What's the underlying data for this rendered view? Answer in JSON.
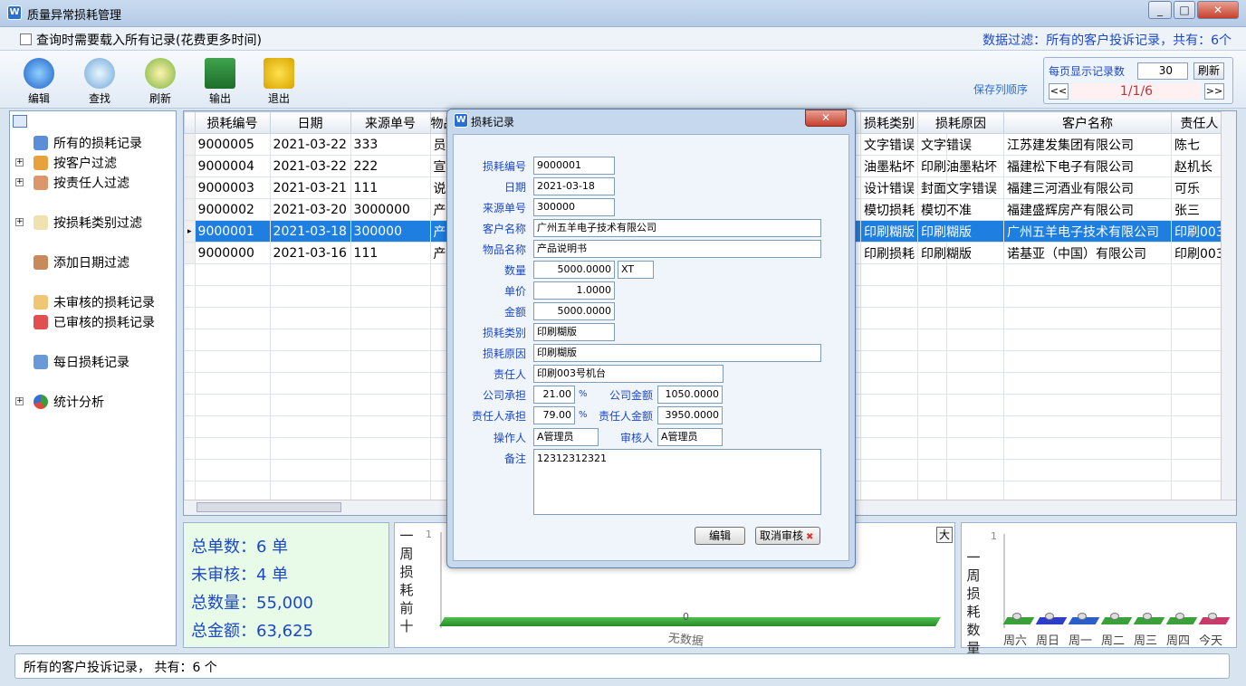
{
  "window": {
    "title": "质量异常损耗管理",
    "minimize": "_",
    "maximize": "□",
    "close": "✕"
  },
  "top": {
    "load_all_label": "查询时需要载入所有记录(花费更多时间)",
    "filter_text": "数据过滤：所有的客户投诉记录，共有：6个"
  },
  "toolbar": {
    "edit": "编辑",
    "find": "查找",
    "refresh": "刷新",
    "export": "输出",
    "exit": "退出",
    "save_order": "保存列顺序"
  },
  "pager": {
    "per_page_label": "每页显示记录数",
    "per_page": "30",
    "refresh": "刷新",
    "prev": "<<",
    "next": ">>",
    "page": "1/1/6"
  },
  "tree": {
    "items": [
      "所有的损耗记录",
      "按客户过滤",
      "按责任人过滤",
      "按损耗类别过滤",
      "添加日期过滤",
      "未审核的损耗记录",
      "已审核的损耗记录",
      "每日损耗记录",
      "统计分析"
    ]
  },
  "grid": {
    "columns": [
      "损耗编号",
      "日期",
      "来源单号",
      "物品",
      "损耗类别",
      "损耗原因",
      "客户名称",
      "责任人"
    ],
    "rows": [
      [
        "9000005",
        "2021-03-22",
        "333",
        "员工手",
        "文字错误",
        "文字错误",
        "江苏建发集团有限公司",
        "陈七"
      ],
      [
        "9000004",
        "2021-03-22",
        "222",
        "宣传单",
        "油墨粘坏",
        "印刷油墨粘坏",
        "福建松下电子有限公司",
        "赵机长"
      ],
      [
        "9000003",
        "2021-03-21",
        "111",
        "说明书",
        "设计错误",
        "封面文字错误",
        "福建三河酒业有限公司",
        "可乐"
      ],
      [
        "9000002",
        "2021-03-20",
        "3000000",
        "产品说",
        "模切损耗",
        "模切不准",
        "福建盛辉房产有限公司",
        "张三"
      ],
      [
        "9000001",
        "2021-03-18",
        "300000",
        "产品说",
        "印刷糊版",
        "印刷糊版",
        "广州五羊电子技术有限公司",
        "印刷003"
      ],
      [
        "9000000",
        "2021-03-16",
        "111",
        "产品说",
        "印刷损耗",
        "印刷糊版",
        "诺基亚（中国）有限公司",
        "印刷003"
      ]
    ]
  },
  "summary": {
    "orders": "总单数：6 单",
    "unaudited": "未审核：4 单",
    "qty": "总数量：55,000",
    "amount": "总金额：63,625"
  },
  "chart1": {
    "vlabel": "一周损耗前十",
    "ytop": "1",
    "zero": "0",
    "no_data": "无数据",
    "big": "大"
  },
  "chart2": {
    "vlabel": "一周损耗数量",
    "ytop": "1",
    "days": [
      "周六",
      "周日",
      "周一",
      "周二",
      "周三",
      "周四",
      "今天"
    ]
  },
  "status": {
    "text": "所有的客户投诉记录， 共有：6 个"
  },
  "dialog": {
    "title": "损耗记录",
    "close": "✕",
    "labels": {
      "id": "损耗编号",
      "date": "日期",
      "source": "来源单号",
      "customer": "客户名称",
      "item": "物品名称",
      "qty": "数量",
      "price": "单价",
      "amount": "金额",
      "category": "损耗类别",
      "reason": "损耗原因",
      "owner": "责任人",
      "company_share": "公司承担",
      "company_amount": "公司金额",
      "owner_share": "责任人承担",
      "owner_amount": "责任人金额",
      "operator": "操作人",
      "auditor": "审核人",
      "remark": "备注",
      "pct": "%"
    },
    "values": {
      "id": "9000001",
      "date": "2021-03-18",
      "source": "300000",
      "customer": "广州五羊电子技术有限公司",
      "item": "产品说明书",
      "qty": "5000.0000",
      "unit": "XT",
      "price": "1.0000",
      "amount": "5000.0000",
      "category": "印刷糊版",
      "reason": "印刷糊版",
      "owner": "印刷003号机台",
      "company_share": "21.00",
      "company_amount": "1050.0000",
      "owner_share": "79.00",
      "owner_amount": "3950.0000",
      "operator": "A管理员",
      "auditor": "A管理员",
      "remark": "12312312321"
    },
    "buttons": {
      "edit": "编辑",
      "cancel_audit": "取消审核"
    }
  }
}
